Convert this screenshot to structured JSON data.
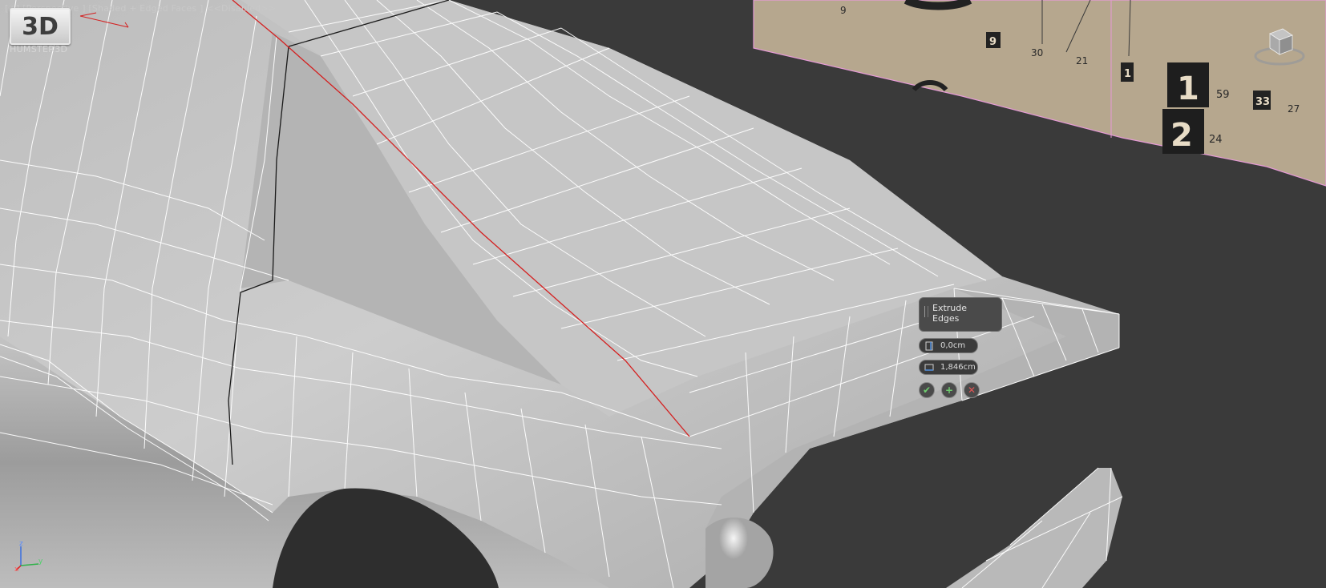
{
  "viewport": {
    "label": "[+] [Perspective ] [Shaded + Edged Faces ]  <<Disabled>>"
  },
  "watermark": {
    "logo_text": "3D",
    "brand": "HUMSTER3D"
  },
  "caddy": {
    "title": "Extrude Edges",
    "height_value": "0,0cm",
    "width_value": "1,846cm",
    "ok_icon": "check-icon",
    "apply_icon": "plus-icon",
    "cancel_icon": "x-icon"
  },
  "blueprint": {
    "labels": [
      "9",
      "9",
      "30",
      "21",
      "1",
      "1",
      "59",
      "33",
      "27",
      "2",
      "24"
    ]
  },
  "axis": {
    "x": "x",
    "y": "y",
    "z": "z"
  },
  "colors": {
    "viewport_bg": "#3a3a3a",
    "mesh_fill": "#c9c9c9",
    "wire": "#ffffff",
    "selected_edge": "#d42020",
    "blueprint_bg": "#b8a890",
    "blueprint_border": "#e59ad6"
  }
}
